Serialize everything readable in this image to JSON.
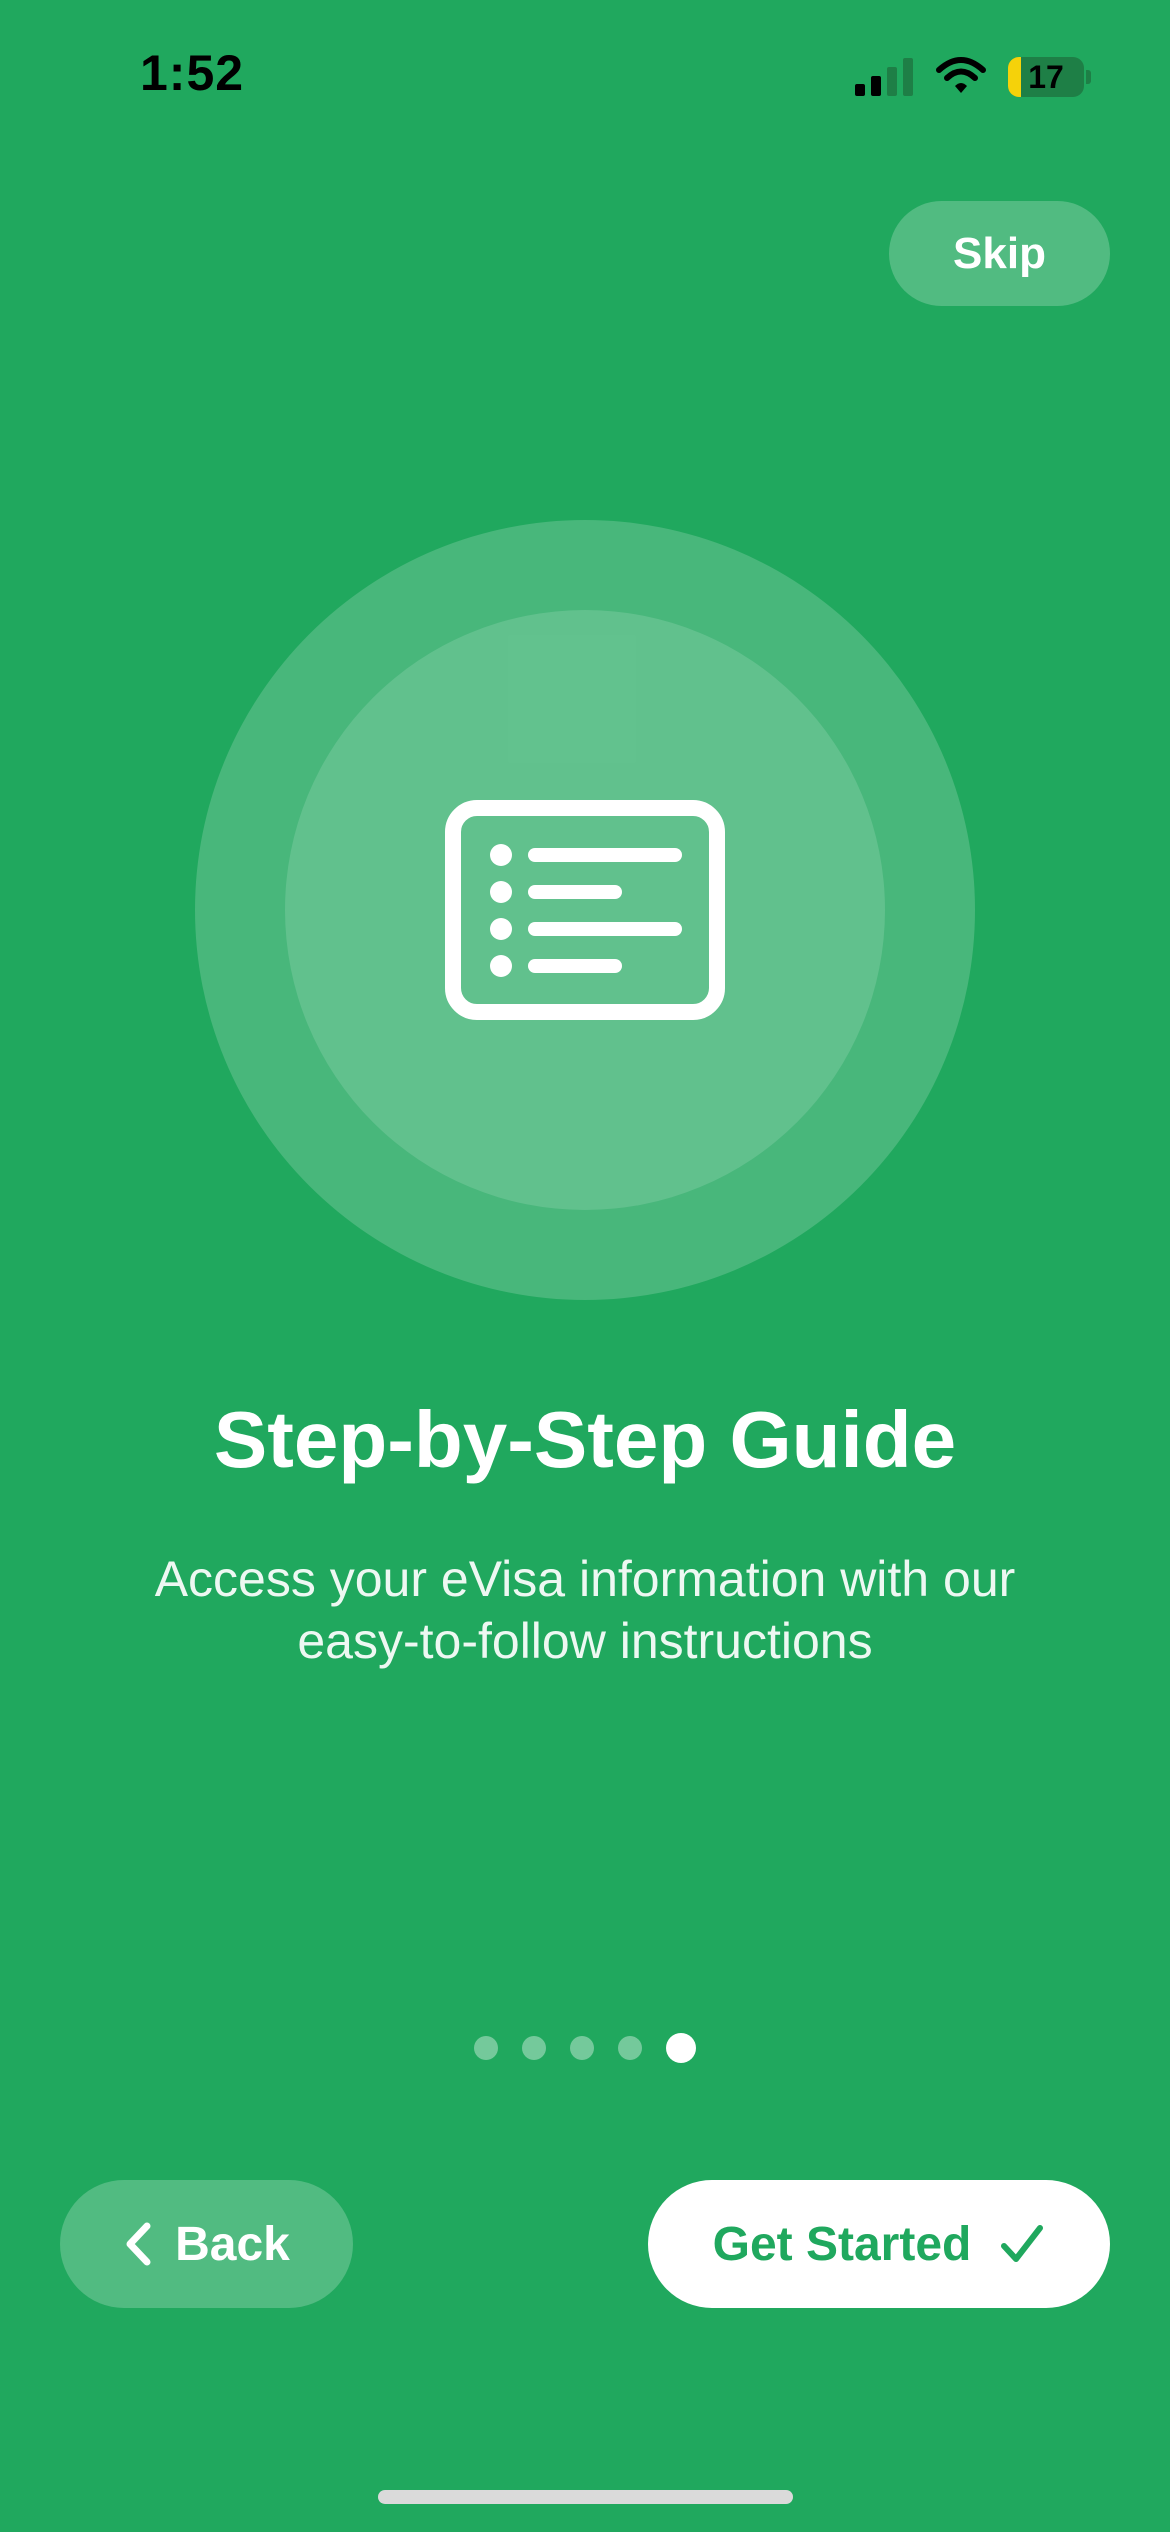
{
  "status_bar": {
    "time": "1:52",
    "battery_level": 17,
    "battery_text": "17",
    "signal_bars_active": 2,
    "signal_bars_total": 4
  },
  "header": {
    "skip_label": "Skip"
  },
  "illustration": {
    "icon": "list-document-icon"
  },
  "content": {
    "title": "Step-by-Step Guide",
    "subtitle_line1": "Access your eVisa information with our",
    "subtitle_line2": "easy-to-follow instructions"
  },
  "pagination": {
    "total": 5,
    "current": 5
  },
  "footer": {
    "back_label": "Back",
    "back_icon": "chevron-left-icon",
    "get_started_label": "Get Started",
    "get_started_icon": "checkmark-icon"
  },
  "colors": {
    "background": "#20A85E",
    "accent": "#20A85E",
    "battery_fill": "#F5D20A"
  }
}
